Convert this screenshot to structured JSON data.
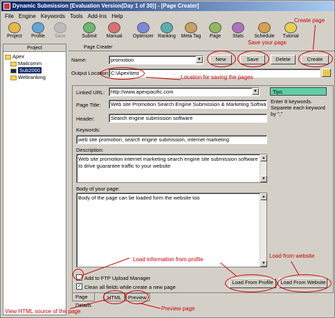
{
  "window": {
    "title": "Dynamic Submission [Evaluation Version(Day 1 of 30)] - [Page Creater]"
  },
  "menu": [
    "File",
    "Engine",
    "Keywords",
    "Tools",
    "Add-Ins",
    "Help"
  ],
  "toolbar": [
    {
      "label": "Project",
      "icon": "project-icon",
      "enabled": true
    },
    {
      "label": "Profile",
      "icon": "profile-icon",
      "enabled": true
    },
    {
      "label": "Save",
      "icon": "save-icon",
      "enabled": false
    },
    {
      "label": "Submit",
      "icon": "submit-icon",
      "enabled": true
    },
    {
      "label": "Manual",
      "icon": "manual-icon",
      "enabled": true
    },
    {
      "label": "Optimizer",
      "icon": "optimizer-icon",
      "enabled": true
    },
    {
      "label": "Ranking",
      "icon": "ranking-icon",
      "enabled": true
    },
    {
      "label": "Meta Tag",
      "icon": "meta-tag-icon",
      "enabled": true
    },
    {
      "label": "Page",
      "icon": "page-icon",
      "enabled": true
    },
    {
      "label": "Stats",
      "icon": "stats-icon",
      "enabled": true
    },
    {
      "label": "Schedule",
      "icon": "schedule-icon",
      "enabled": true
    },
    {
      "label": "Tutorial",
      "icon": "tutorial-icon",
      "enabled": true
    }
  ],
  "project_panel": {
    "header": "Project",
    "tree": [
      {
        "label": "Apex",
        "selected": false
      },
      {
        "label": "Mailcomm",
        "selected": false
      },
      {
        "label": "Sub2000",
        "selected": true
      },
      {
        "label": "Webranking",
        "selected": false
      }
    ]
  },
  "page_creater": {
    "header": "Page Creater",
    "name_label": "Name:",
    "name_value": "promotion",
    "new_button": "New",
    "save_button": "Save",
    "delete_button": "Delete",
    "create_button": "Create",
    "output_label": "Output Location:",
    "output_value": "C:\\Apex\\test",
    "linked_url_label": "Linked URL:",
    "linked_url_value": "http://www.apexpacific.com",
    "page_title_label": "Page Title:",
    "page_title_value": "Web site Promotion Search Engine Submission & Marketing Software",
    "header_label": "Header:",
    "header_value": "Search engine submission software",
    "keywords_label": "Keywords:",
    "keywords_value": "web site promotion, search engine submission, internet marketing",
    "description_label": "Description:",
    "description_value": "Web site promotion internet marketing search engine site submission software to drive guarantee traffic to your website",
    "body_label": "Body of your page:",
    "body_value": "Body of the page can be loaded form the website too",
    "tips_title": "Tips",
    "tips_text": "Enter 8 keywords. Separete each keyword by \",\"",
    "ftp_label": "Add to FTP Upload Manager",
    "ftp_checked": false,
    "clean_label": "Clean all fields while create a new page",
    "clean_checked": true,
    "load_profile_button": "Load From Profile",
    "load_website_button": "Load From Website",
    "tabs": [
      "Page Details",
      "HTML",
      "Preview"
    ]
  },
  "annotations": {
    "create_page": "Create page",
    "save_page": "Save your page",
    "location": "Location for saving the pages",
    "load_profile": "Load information from profile",
    "load_website": "Load from website",
    "view_html": "View HTML source of the page",
    "preview": "Preview page"
  },
  "colors": {
    "annotation": "#cc0000",
    "titlebar": "#0a246a",
    "tips": "#5ecfa8"
  }
}
